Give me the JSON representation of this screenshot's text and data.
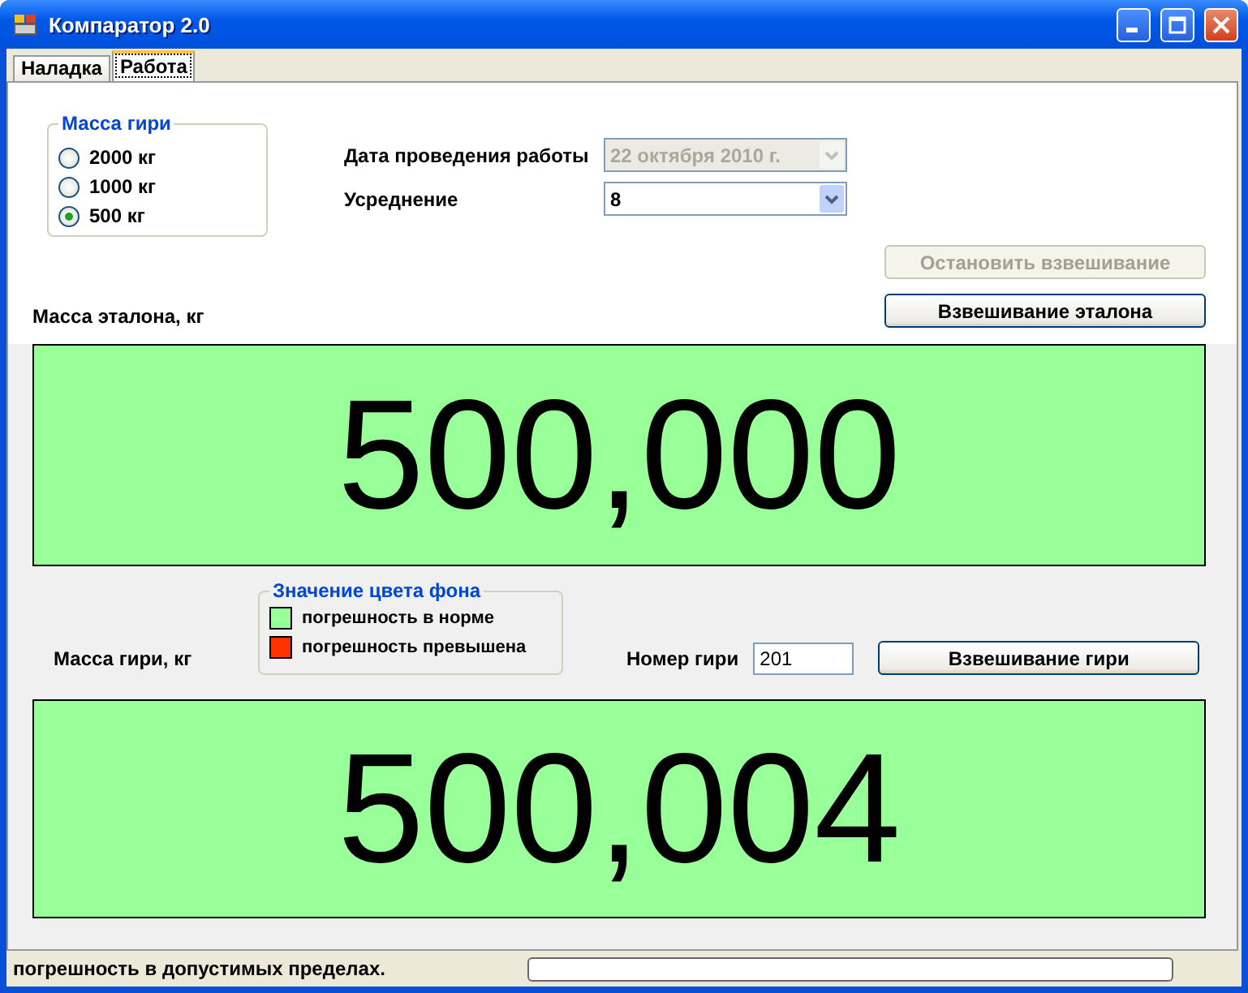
{
  "window": {
    "title": "Компаратор 2.0"
  },
  "tabs": [
    {
      "label": "Наладка",
      "selected": false
    },
    {
      "label": "Работа",
      "selected": true
    }
  ],
  "weight_group": {
    "title": "Масса гири",
    "options": [
      {
        "label": "2000 кг",
        "selected": false
      },
      {
        "label": "1000 кг",
        "selected": false
      },
      {
        "label": "500 кг",
        "selected": true
      }
    ]
  },
  "fields": [
    {
      "label": "Дата проведения работы",
      "value": "22  октября  2010 г.",
      "disabled": true
    },
    {
      "label": "Усреднение",
      "value": "8",
      "disabled": false
    }
  ],
  "stop_button": {
    "label": "Остановить взвешивание",
    "disabled": true
  },
  "reference": {
    "label": "Масса эталона, кг",
    "button": "Взвешивание эталона",
    "value": "500,000",
    "color": "#99ff99"
  },
  "legend": {
    "title": "Значение цвета фона",
    "items": [
      {
        "label": "погрешность в норме",
        "color": "#99ff99"
      },
      {
        "label": "погрешность превышена",
        "color": "#ff3300"
      }
    ]
  },
  "weight": {
    "label": "Масса гири, кг",
    "number_label": "Номер гири",
    "number_value": "201",
    "button": "Взвешивание гири",
    "value": "500,004",
    "color": "#99ff99"
  },
  "status_bar": {
    "text": "погрешность в допустимых пределах.",
    "progress": {
      "level": 0
    }
  }
}
